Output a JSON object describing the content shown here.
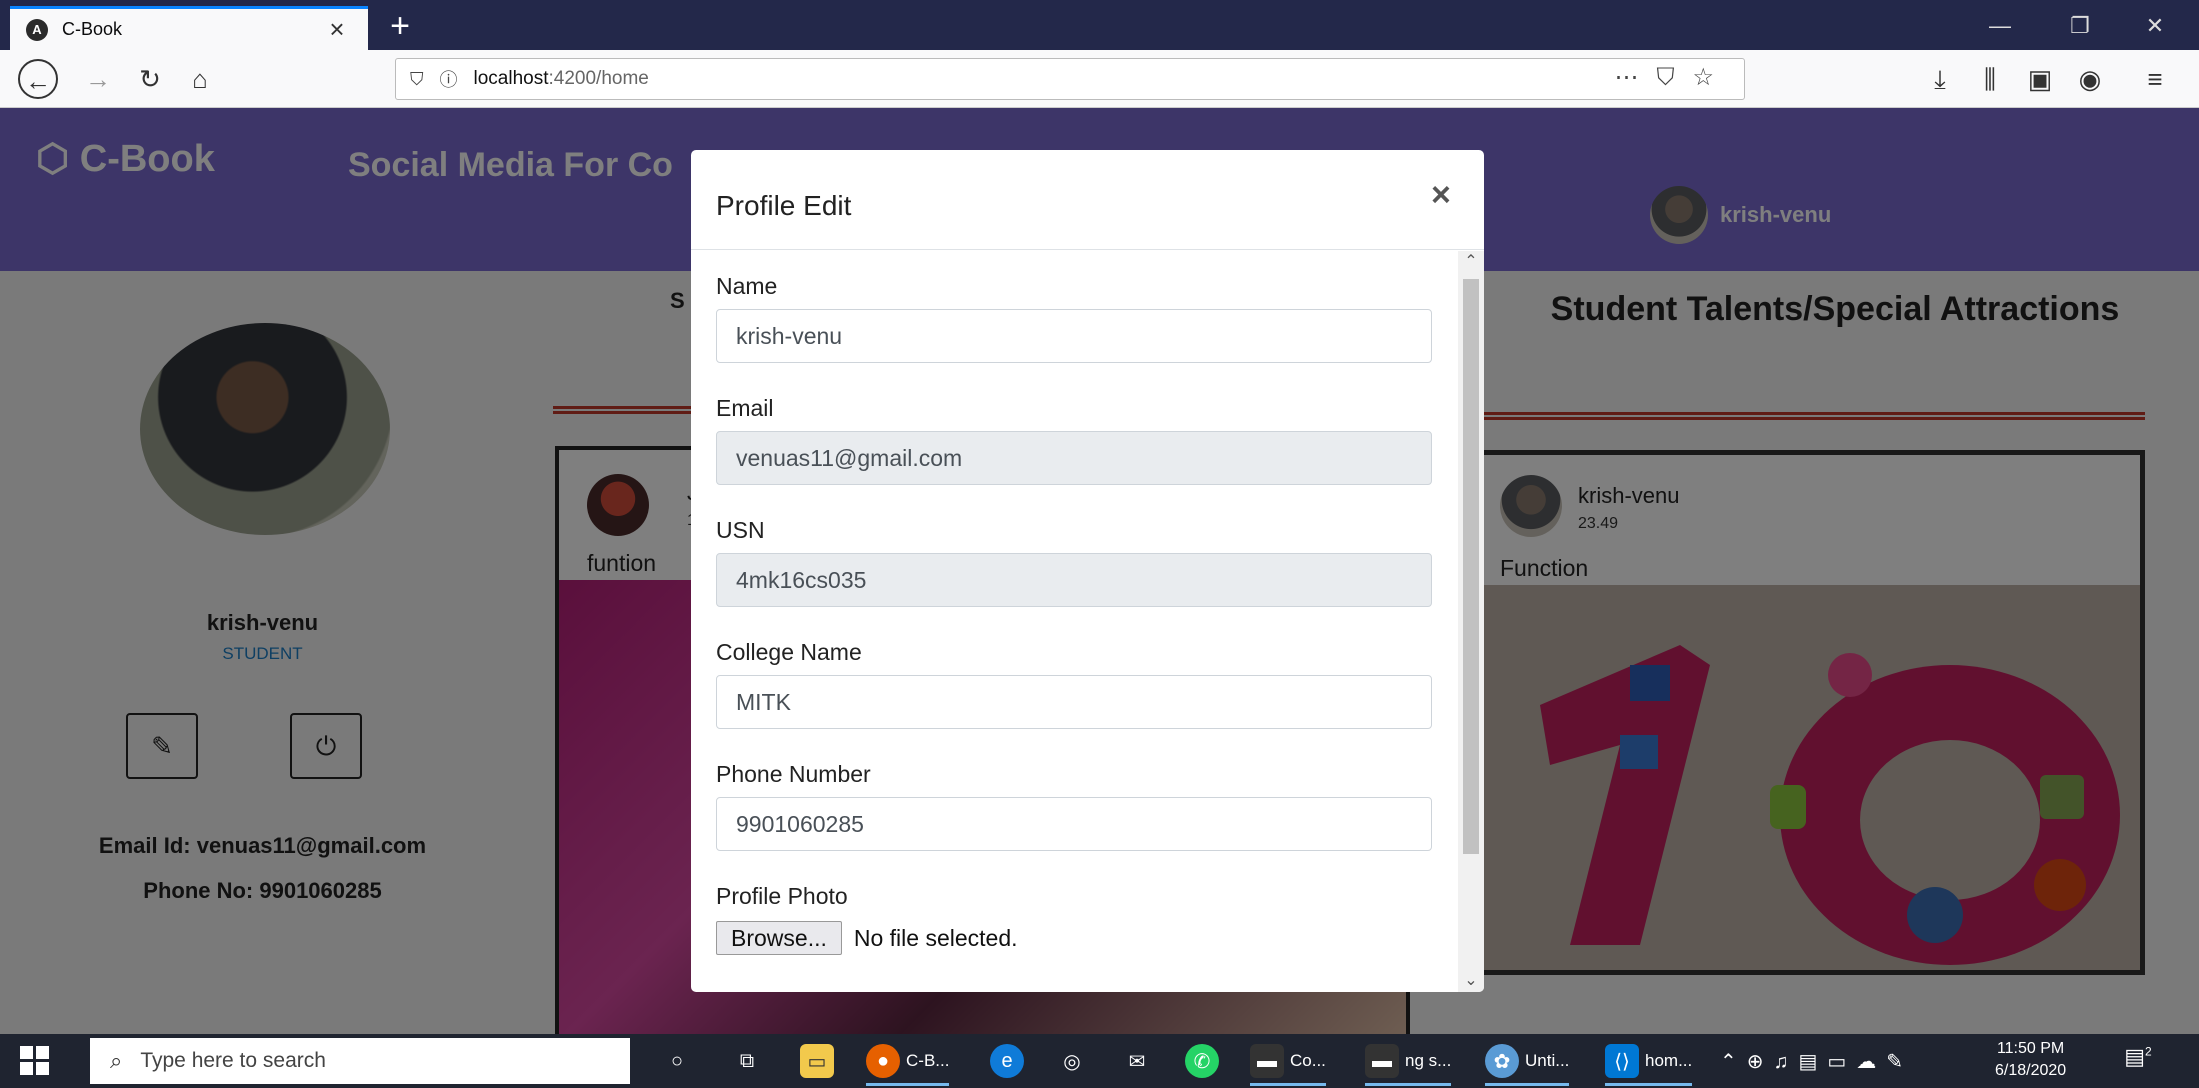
{
  "browser": {
    "tab_title": "C-Book",
    "tab_favicon": "A",
    "url_host": "localhost",
    "url_path": ":4200/home",
    "window_controls": [
      "—",
      "❐",
      "✕"
    ]
  },
  "app": {
    "brand": "C-Book",
    "tagline": "Social Media For Co",
    "header_user": "krish-venu"
  },
  "profile": {
    "name": "krish-venu",
    "role": "STUDENT",
    "email_line": "Email Id: venuas11@gmail.com",
    "phone_line": "Phone No: 9901060285"
  },
  "feed": {
    "heading_partial": "S",
    "post_name_partial": "J",
    "post_sub_partial": "1",
    "post_caption": "funtion"
  },
  "talents": {
    "heading": "Student Talents/Special Attractions",
    "post_user": "krish-venu",
    "post_time": "23.49",
    "post_caption": "Function",
    "accent_color": "#c0392b"
  },
  "modal": {
    "title": "Profile Edit",
    "close_glyph": "×",
    "fields": [
      {
        "label": "Name",
        "value": "krish-venu"
      },
      {
        "label": "Email",
        "value": "venuas11@gmail.com"
      },
      {
        "label": "USN",
        "value": "4mk16cs035"
      },
      {
        "label": "College Name",
        "value": "MITK"
      },
      {
        "label": "Phone Number",
        "value": "9901060285"
      }
    ],
    "photo_label": "Profile Photo",
    "browse_label": "Browse...",
    "file_status": "No file selected."
  },
  "taskbar": {
    "search_placeholder": "Type here to search",
    "items": [
      "C-B...",
      "Co...",
      "ng s...",
      "Unti...",
      "hom..."
    ],
    "time": "11:50 PM",
    "date": "6/18/2020",
    "notification_count": "2"
  }
}
